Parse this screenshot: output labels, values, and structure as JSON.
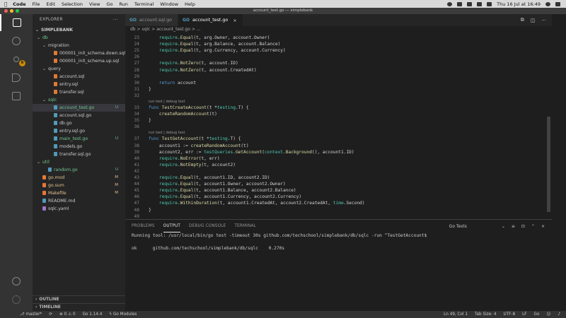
{
  "menubar": {
    "app": "Code",
    "items": [
      "File",
      "Edit",
      "Selection",
      "View",
      "Go",
      "Run",
      "Terminal",
      "Window",
      "Help"
    ],
    "clock": "Thu 16 Jul at 16:49"
  },
  "window": {
    "title": "account_test.go — simplebank"
  },
  "sidebar": {
    "header": "EXPLORER",
    "project": "SIMPLEBANK",
    "tree": [
      {
        "label": "db",
        "kind": "folder",
        "depth": 0,
        "open": true,
        "color": "green"
      },
      {
        "label": "migration",
        "kind": "folder",
        "depth": 1,
        "open": true
      },
      {
        "label": "000001_init_schema.down.sql",
        "kind": "sql",
        "depth": 2
      },
      {
        "label": "000001_init_schema.up.sql",
        "kind": "sql",
        "depth": 2
      },
      {
        "label": "query",
        "kind": "folder",
        "depth": 1,
        "open": true
      },
      {
        "label": "account.sql",
        "kind": "sql",
        "depth": 2
      },
      {
        "label": "entry.sql",
        "kind": "sql",
        "depth": 2
      },
      {
        "label": "transfer.sql",
        "kind": "sql",
        "depth": 2
      },
      {
        "label": "sqlc",
        "kind": "folder",
        "depth": 1,
        "open": true,
        "color": "green"
      },
      {
        "label": "account_test.go",
        "kind": "go",
        "depth": 2,
        "status": "U",
        "color": "green",
        "selected": true
      },
      {
        "label": "account.sql.go",
        "kind": "go",
        "depth": 2
      },
      {
        "label": "db.go",
        "kind": "go",
        "depth": 2
      },
      {
        "label": "entry.sql.go",
        "kind": "go",
        "depth": 2
      },
      {
        "label": "main_test.go",
        "kind": "go",
        "depth": 2,
        "status": "U",
        "color": "green"
      },
      {
        "label": "models.go",
        "kind": "go",
        "depth": 2
      },
      {
        "label": "transfer.sql.go",
        "kind": "go",
        "depth": 2
      },
      {
        "label": "util",
        "kind": "folder",
        "depth": 0,
        "open": true,
        "color": "green"
      },
      {
        "label": "random.go",
        "kind": "go",
        "depth": 1,
        "status": "U",
        "color": "green"
      },
      {
        "label": "go.mod",
        "kind": "mod",
        "depth": 0,
        "status": "M",
        "color": "orange"
      },
      {
        "label": "go.sum",
        "kind": "mod",
        "depth": 0,
        "status": "M",
        "color": "orange"
      },
      {
        "label": "Makefile",
        "kind": "make",
        "depth": 0,
        "status": "M",
        "color": "orange"
      },
      {
        "label": "README.md",
        "kind": "md",
        "depth": 0
      },
      {
        "label": "sqlc.yaml",
        "kind": "yaml",
        "depth": 0
      }
    ],
    "outline": "OUTLINE",
    "timeline": "TIMELINE"
  },
  "tabs": [
    {
      "label": "account.sql.go",
      "active": false
    },
    {
      "label": "account_test.go",
      "active": true
    }
  ],
  "breadcrumb": "db > sqlc > account_test.go > ...",
  "editor": {
    "lines": [
      {
        "n": "23",
        "text": "\trequire.Equal(t, arg.Owner, account.Owner)"
      },
      {
        "n": "24",
        "text": "\trequire.Equal(t, arg.Balance, account.Balance)"
      },
      {
        "n": "25",
        "text": "\trequire.Equal(t, arg.Currency, account.Currency)"
      },
      {
        "n": "26",
        "text": ""
      },
      {
        "n": "27",
        "text": "\trequire.NotZero(t, account.ID)"
      },
      {
        "n": "28",
        "text": "\trequire.NotZero(t, account.CreatedAt)"
      },
      {
        "n": "29",
        "text": ""
      },
      {
        "n": "30",
        "text": "\treturn account"
      },
      {
        "n": "31",
        "text": "}"
      },
      {
        "n": "32",
        "text": ""
      },
      {
        "lens": "run test | debug test"
      },
      {
        "n": "33",
        "text": "func TestCreateAccount(t *testing.T) {"
      },
      {
        "n": "34",
        "text": "\tcreateRandomAccount(t)"
      },
      {
        "n": "35",
        "text": "}"
      },
      {
        "n": "36",
        "text": ""
      },
      {
        "lens": "run test | debug test"
      },
      {
        "n": "37",
        "text": "func TestGetAccount(t *testing.T) {"
      },
      {
        "n": "38",
        "text": "\taccount1 := createRandomAccount(t)"
      },
      {
        "n": "39",
        "text": "\taccount2, err := testQueries.GetAccount(context.Background(), account1.ID)"
      },
      {
        "n": "40",
        "text": "\trequire.NoError(t, err)"
      },
      {
        "n": "41",
        "text": "\trequire.NotEmpty(t, account2)"
      },
      {
        "n": "42",
        "text": ""
      },
      {
        "n": "43",
        "text": "\trequire.Equal(t, account1.ID, account2.ID)"
      },
      {
        "n": "44",
        "text": "\trequire.Equal(t, account1.Owner, account2.Owner)"
      },
      {
        "n": "45",
        "text": "\trequire.Equal(t, account1.Balance, account2.Balance)"
      },
      {
        "n": "46",
        "text": "\trequire.Equal(t, account1.Currency, account2.Currency)"
      },
      {
        "n": "47",
        "text": "\trequire.WithinDuration(t, account1.CreatedAt, account2.CreatedAt, time.Second)"
      },
      {
        "n": "48",
        "text": "}"
      },
      {
        "n": "49",
        "text": ""
      }
    ]
  },
  "panel": {
    "tabs": [
      "PROBLEMS",
      "OUTPUT",
      "DEBUG CONSOLE",
      "TERMINAL"
    ],
    "active_tab": "OUTPUT",
    "channel": "Go Tests",
    "output": [
      "Running tool: /usr/local/bin/go test -timeout 30s github.com/techschool/simplebank/db/sqlc -run ^TestGetAccount$",
      "",
      "ok      github.com/techschool/simplebank/db/sqlc    0.270s"
    ]
  },
  "statusbar": {
    "branch": "master*",
    "sync": "⟳",
    "errors": "0",
    "warnings": "0",
    "go_version": "Go 1.14.4",
    "go_modules": "Go Modules",
    "position": "Ln 49, Col 1",
    "tab_size": "Tab Size: 4",
    "encoding": "UTF-8",
    "eol": "LF",
    "language": "Go"
  },
  "colors": {
    "accent_green": "#73c991",
    "accent_orange": "#e2c08d",
    "go_blue": "#519aba"
  }
}
